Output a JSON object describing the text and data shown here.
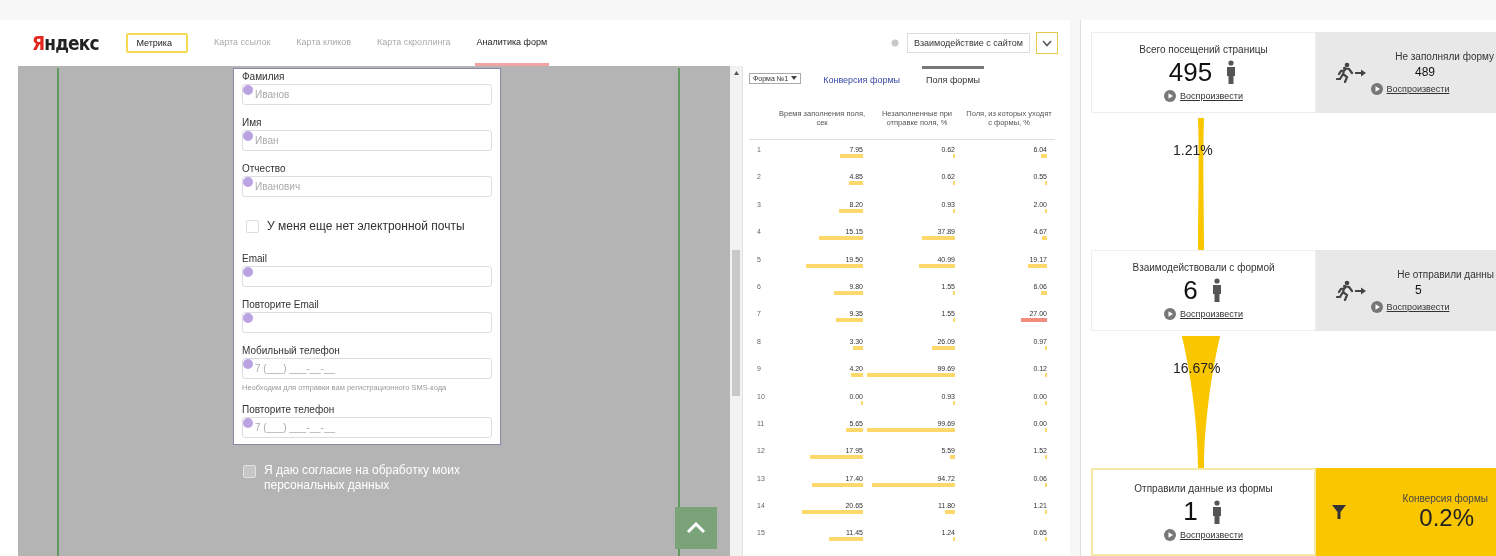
{
  "header": {
    "logo": {
      "accent": "Я",
      "rest": "ндекс"
    },
    "product": "Метрика",
    "nav": [
      {
        "label": "Карта ссылок",
        "selected": false
      },
      {
        "label": "Карта кликов",
        "selected": false
      },
      {
        "label": "Карта скроллинга",
        "selected": false
      },
      {
        "label": "Аналитика форм",
        "selected": true
      }
    ],
    "segment": "Взаимодействие с сайтом"
  },
  "preview": {
    "form": [
      {
        "kind": "field",
        "label": "Фамилия",
        "placeholder": "Иванов"
      },
      {
        "kind": "field",
        "label": "Имя",
        "placeholder": "Иван"
      },
      {
        "kind": "field",
        "label": "Отчество",
        "placeholder": "Иванович"
      },
      {
        "kind": "checkbox",
        "label": "У меня еще нет электронной почты",
        "checked": false
      },
      {
        "kind": "field",
        "label": "Email"
      },
      {
        "kind": "field",
        "label": "Повторите Email"
      },
      {
        "kind": "field",
        "label": "Мобильный телефон",
        "placeholder": "7 (___) ___-__-__",
        "hint": "Необходим для отправки вам регистрационного SMS-кода"
      },
      {
        "kind": "field",
        "label": "Повторите телефон",
        "placeholder": "7 (___) ___-__-__"
      }
    ],
    "consent": {
      "label": "Я даю согласие на обработку моих персональных данных",
      "checked": false
    }
  },
  "table": {
    "form_select": "Форма №1",
    "tabs": [
      {
        "label": "Конверсия формы",
        "selected": false
      },
      {
        "label": "Поля формы",
        "selected": true
      }
    ],
    "columns": [
      "Время заполнения поля, сек",
      "Незаполненные при отправке поля, %",
      "Поля, из которых уходят с формы, %"
    ],
    "rows": [
      {
        "n": "1",
        "cells": [
          {
            "value": "7.95",
            "color": "#fcd96a"
          },
          {
            "value": "0.62",
            "color": "#fcd96a"
          },
          {
            "value": "6.04",
            "color": "#fcd96a"
          }
        ]
      },
      {
        "n": "2",
        "cells": [
          {
            "value": "4.85",
            "color": "#fcd96a"
          },
          {
            "value": "0.62",
            "color": "#fcd96a"
          },
          {
            "value": "0.55",
            "color": "#fcd96a"
          }
        ]
      },
      {
        "n": "3",
        "cells": [
          {
            "value": "8.20",
            "color": "#fcd96a"
          },
          {
            "value": "0.93",
            "color": "#fcd96a"
          },
          {
            "value": "2.00",
            "color": "#fcd96a"
          }
        ]
      },
      {
        "n": "4",
        "cells": [
          {
            "value": "15.15",
            "color": "#fcd96a"
          },
          {
            "value": "37.89",
            "color": "#fcd96a"
          },
          {
            "value": "4.67",
            "color": "#fcd96a"
          }
        ]
      },
      {
        "n": "5",
        "cells": [
          {
            "value": "19.50",
            "color": "#fcd96a"
          },
          {
            "value": "40.99",
            "color": "#fcd96a"
          },
          {
            "value": "19.17",
            "color": "#fcd96a"
          }
        ]
      },
      {
        "n": "6",
        "cells": [
          {
            "value": "9.80",
            "color": "#fcd96a"
          },
          {
            "value": "1.55",
            "color": "#fcd96a"
          },
          {
            "value": "6.06",
            "color": "#fcd96a"
          }
        ]
      },
      {
        "n": "7",
        "cells": [
          {
            "value": "9.35",
            "color": "#fcd96a"
          },
          {
            "value": "1.55",
            "color": "#fcd96a"
          },
          {
            "value": "27.00",
            "color": "#f08c80"
          }
        ]
      },
      {
        "n": "8",
        "cells": [
          {
            "value": "3.30",
            "color": "#fcd96a"
          },
          {
            "value": "26.09",
            "color": "#fcd96a"
          },
          {
            "value": "0.97",
            "color": "#fcd96a"
          }
        ]
      },
      {
        "n": "9",
        "cells": [
          {
            "value": "4.20",
            "color": "#fcd96a"
          },
          {
            "value": "99.69",
            "color": "#fcd96a"
          },
          {
            "value": "0.12",
            "color": "#fcd96a"
          }
        ]
      },
      {
        "n": "10",
        "cells": [
          {
            "value": "0.00",
            "color": "#fcd96a"
          },
          {
            "value": "0.93",
            "color": "#fcd96a"
          },
          {
            "value": "0.00",
            "color": "#fcd96a"
          }
        ]
      },
      {
        "n": "11",
        "cells": [
          {
            "value": "5.65",
            "color": "#fcd96a"
          },
          {
            "value": "99.69",
            "color": "#fcd96a"
          },
          {
            "value": "0.00",
            "color": "#fcd96a"
          }
        ]
      },
      {
        "n": "12",
        "cells": [
          {
            "value": "17.95",
            "color": "#fcd96a"
          },
          {
            "value": "5.59",
            "color": "#fcd96a"
          },
          {
            "value": "1.52",
            "color": "#fcd96a"
          }
        ]
      },
      {
        "n": "13",
        "cells": [
          {
            "value": "17.40",
            "color": "#fcd96a"
          },
          {
            "value": "94.72",
            "color": "#fcd96a"
          },
          {
            "value": "0.06",
            "color": "#fcd96a"
          }
        ]
      },
      {
        "n": "14",
        "cells": [
          {
            "value": "20.65",
            "color": "#fcd96a"
          },
          {
            "value": "11.80",
            "color": "#fcd96a"
          },
          {
            "value": "1.21",
            "color": "#fcd96a"
          }
        ]
      },
      {
        "n": "15",
        "cells": [
          {
            "value": "11.45",
            "color": "#fcd96a"
          },
          {
            "value": "1.24",
            "color": "#fcd96a"
          },
          {
            "value": "0.65",
            "color": "#fcd96a"
          }
        ]
      }
    ]
  },
  "funnel": {
    "stages": [
      {
        "kind": "step",
        "title": "Всего посещений страницы",
        "count": "495",
        "play": "Воспроизвести",
        "exit": {
          "title": "Не заполняли форму",
          "count": "489",
          "play": "Воспроизвести"
        }
      },
      {
        "kind": "step",
        "title": "Взаимодействовали с формой",
        "count": "6",
        "play": "Воспроизвести",
        "exit": {
          "title": "Не отправили данны",
          "count": "5",
          "play": "Воспроизвести"
        }
      },
      {
        "kind": "final",
        "title": "Отправили данные из формы",
        "count": "1",
        "play": "Воспроизвести",
        "conversion": {
          "title": "Конверсия формы",
          "value": "0.2%"
        }
      }
    ],
    "steps": [
      {
        "percent": "1.21%"
      },
      {
        "percent": "16.67%"
      }
    ]
  }
}
